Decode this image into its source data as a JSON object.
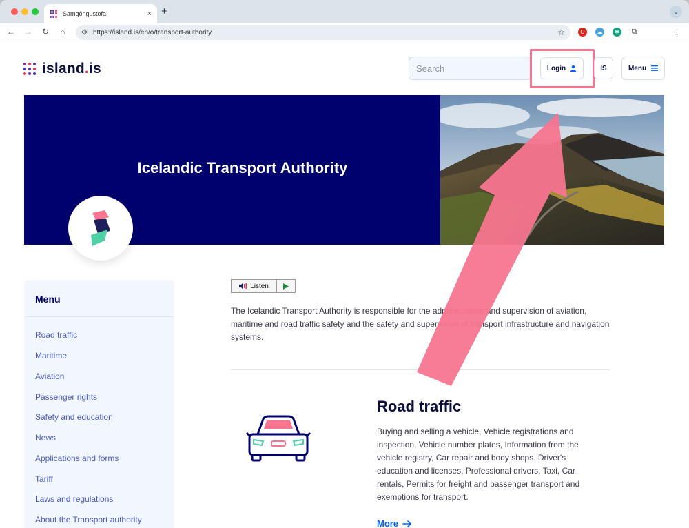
{
  "browser": {
    "tab_title": "Samgöngustofa",
    "tab_close": "×",
    "new_tab": "+",
    "url": "https://island.is/en/o/transport-authority"
  },
  "header": {
    "logo_text_main": "island",
    "logo_text_dot": ".",
    "logo_text_tld": "is",
    "search_placeholder": "Search",
    "login_label": "Login",
    "language_label": "IS",
    "menu_label": "Menu"
  },
  "hero": {
    "title": "Icelandic Transport Authority"
  },
  "sidebar": {
    "title": "Menu",
    "items": [
      {
        "label": "Road traffic"
      },
      {
        "label": "Maritime"
      },
      {
        "label": "Aviation"
      },
      {
        "label": "Passenger rights"
      },
      {
        "label": "Safety and education"
      },
      {
        "label": "News"
      },
      {
        "label": "Applications and forms"
      },
      {
        "label": "Tariff"
      },
      {
        "label": "Laws and regulations"
      },
      {
        "label": "About the Transport authority"
      }
    ]
  },
  "main": {
    "listen_label": "Listen",
    "intro_text": "The Icelandic Transport Authority is responsible for the administration and supervision of aviation, maritime and road traffic safety and the safety and supervision of transport infrastructure and navigation systems.",
    "road_traffic": {
      "title": "Road traffic",
      "description": "Buying and selling a vehicle, Vehicle registrations and inspection, Vehicle number plates, Information from the vehicle registry, Car repair and body shops. Driver's education and licenses, Professional drivers, Taxi, Car rentals, Permits for freight and passenger transport and exemptions for transport.",
      "more_label": "More"
    }
  },
  "colors": {
    "brand_navy": "#00006e",
    "highlight_pink": "#f7758f",
    "link_blue": "#0061ff"
  }
}
